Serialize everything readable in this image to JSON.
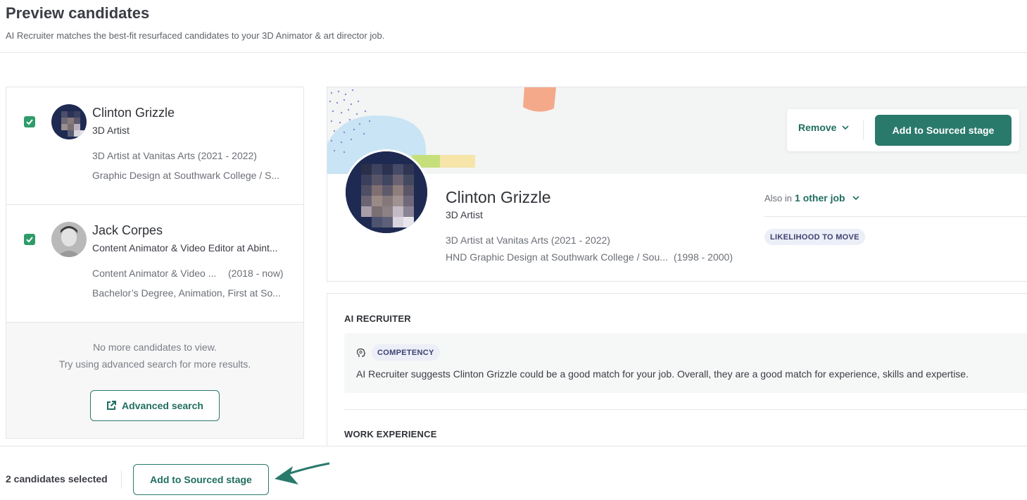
{
  "header": {
    "title": "Preview candidates",
    "subtitle": "AI Recruiter matches the best-fit resurfaced candidates to your 3D Animator & art director job."
  },
  "candidates": [
    {
      "name": "Clinton Grizzle",
      "role": "3D Artist",
      "line1": "3D Artist at Vanitas Arts (2021 - 2022)",
      "line1_date": "",
      "line2": "Graphic Design at Southwark College / S...",
      "checked": true
    },
    {
      "name": "Jack Corpes",
      "role": "Content Animator & Video Editor at Abint...",
      "line1": "Content Animator & Video ...",
      "line1_date": "(2018 - now)",
      "line2": "Bachelor’s Degree, Animation, First at So...",
      "checked": true
    }
  ],
  "no_more": {
    "line1": "No more candidates to view.",
    "line2": "Try using advanced search for more results.",
    "button": "Advanced search"
  },
  "profile": {
    "name": "Clinton Grizzle",
    "role": "3D Artist",
    "line1": "3D Artist at Vanitas Arts (2021 - 2022)",
    "line2": "HND Graphic Design at Southwark College / Sou...",
    "line2_dates": "(1998 - 2000)",
    "also_in_prefix": "Also in",
    "also_in_link": "1 other job",
    "likelihood_badge": "LIKELIHOOD TO MOVE",
    "remove_label": "Remove",
    "add_label": "Add to Sourced stage"
  },
  "ai": {
    "heading": "AI RECRUITER",
    "badge": "COMPETENCY",
    "text": "AI Recruiter suggests Clinton Grizzle could be a good match for your job. Overall, they are a good match for experience, skills and expertise."
  },
  "work": {
    "heading": "WORK EXPERIENCE"
  },
  "footer": {
    "count": "2 candidates selected",
    "button": "Add to Sourced stage"
  },
  "colors": {
    "accent": "#2a7a6c",
    "checkbox": "#2e9c6a",
    "badge_bg": "#eceef8"
  }
}
